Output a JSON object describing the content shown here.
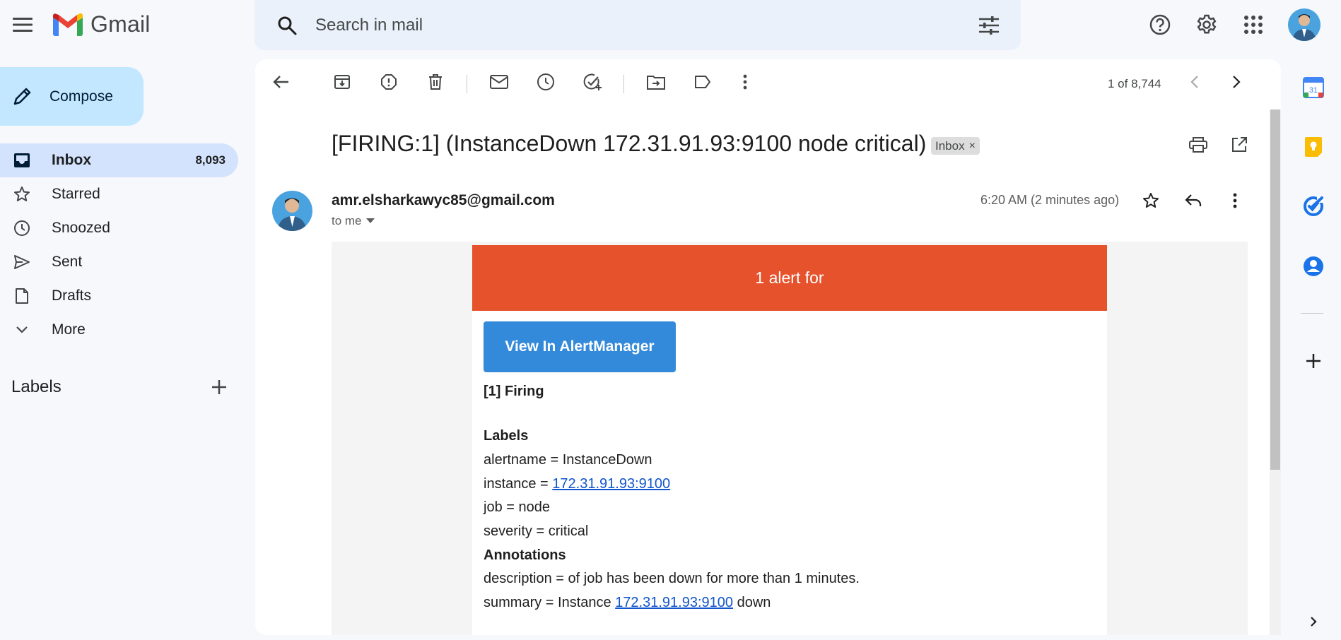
{
  "app": {
    "name": "Gmail",
    "brand_colors": [
      "#ea4335",
      "#4285f4",
      "#fbbc04",
      "#34a853"
    ]
  },
  "search": {
    "placeholder": "Search in mail"
  },
  "header": {
    "icons": [
      "menu-icon",
      "search-icon",
      "filter-icon",
      "help-icon",
      "settings-icon",
      "apps-icon",
      "account-avatar"
    ]
  },
  "sidebar": {
    "compose_label": "Compose",
    "items": [
      {
        "label": "Inbox",
        "count": "8,093",
        "icon": "inbox-icon",
        "active": true
      },
      {
        "label": "Starred",
        "count": "",
        "icon": "star-icon"
      },
      {
        "label": "Snoozed",
        "count": "",
        "icon": "clock-icon"
      },
      {
        "label": "Sent",
        "count": "",
        "icon": "send-icon"
      },
      {
        "label": "Drafts",
        "count": "",
        "icon": "draft-icon"
      },
      {
        "label": "More",
        "count": "",
        "icon": "chevron-down-icon"
      }
    ],
    "labels_title": "Labels"
  },
  "toolbar": {
    "pager": "1 of 8,744",
    "icons": [
      "back-arrow-icon",
      "archive-icon",
      "report-spam-icon",
      "delete-icon",
      "mark-unread-icon",
      "snooze-icon",
      "add-task-icon",
      "move-to-icon",
      "label-icon",
      "more-vert-icon",
      "newer-icon",
      "older-icon"
    ]
  },
  "email": {
    "subject": "[FIRING:1] (InstanceDown 172.31.91.93:9100 node critical)",
    "chip_label": "Inbox",
    "chip_close": "×",
    "sender": "amr.elsharkawyc85@gmail.com",
    "to": "to me",
    "time": "6:20 AM (2 minutes ago)",
    "body": {
      "banner": "1 alert for",
      "button": "View In AlertManager",
      "firing": "[1] Firing",
      "labels_heading": "Labels",
      "alertname": "alertname = InstanceDown",
      "instance_prefix": "instance = ",
      "instance_link": "172.31.91.93:9100",
      "job": "job = node",
      "severity": "severity = critical",
      "annotations_heading": "Annotations",
      "description": "description = of job has been down for more than 1 minutes.",
      "summary_prefix": "summary = Instance ",
      "summary_link": "172.31.91.93:9100",
      "summary_suffix": " down"
    }
  },
  "side_panel": {
    "apps": [
      "calendar-icon",
      "keep-icon",
      "tasks-icon",
      "contacts-icon",
      "add-addon-icon",
      "expand-panel-icon"
    ],
    "calendar_day": "31"
  },
  "colors": {
    "alert_banner": "#e6522c",
    "alertmanager_button": "#348ada",
    "compose_bg": "#c2e7ff",
    "active_nav_bg": "#d3e3fd",
    "link": "#1155cc"
  }
}
